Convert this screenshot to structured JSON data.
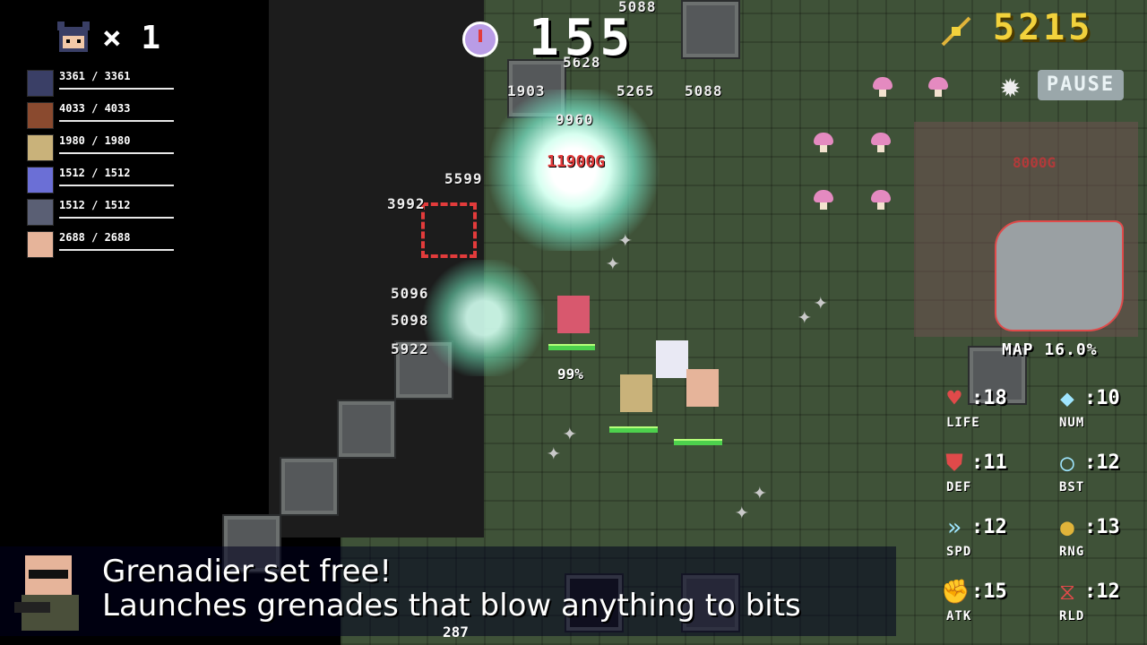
{
  "hud": {
    "lives_icon": "player-face-icon",
    "lives_text": "× 1",
    "timer_icon": "clock-icon",
    "timer": "155",
    "gold_icon": "gold-key-icon",
    "gold": "5215",
    "pause_icon": "gear-icon",
    "pause_label": "PAUSE",
    "map_label": "MAP 16.0%",
    "minimap_gold": "8000G"
  },
  "party": [
    {
      "face": "warrior-face-icon",
      "hp": "3361 / 3361"
    },
    {
      "face": "beast-face-icon",
      "hp": "4033 / 4033"
    },
    {
      "face": "elf-face-icon",
      "hp": "1980 / 1980"
    },
    {
      "face": "rabbit-face-icon",
      "hp": "1512 / 1512"
    },
    {
      "face": "fighter-face-icon",
      "hp": "1512 / 1512"
    },
    {
      "face": "grenadier-face-icon",
      "hp": "2688 / 2688"
    }
  ],
  "stats": [
    {
      "icon": "potion-icon",
      "value": ":18",
      "label": "LIFE",
      "color": "#e04a4a"
    },
    {
      "icon": "crystal-icon",
      "value": ":10",
      "label": "NUM",
      "color": "#9fe6ff"
    },
    {
      "icon": "shield-icon",
      "value": ":11",
      "label": "DEF",
      "color": "#e04a4a"
    },
    {
      "icon": "ring-icon",
      "value": ":12",
      "label": "BST",
      "color": "#9fe6ff"
    },
    {
      "icon": "boot-icon",
      "value": ":12",
      "label": "SPD",
      "color": "#9fe6ff"
    },
    {
      "icon": "bomb-icon",
      "value": ":13",
      "label": "RNG",
      "color": "#e0b43a"
    },
    {
      "icon": "fist-icon",
      "value": ":15",
      "label": "ATK",
      "color": "#e04a4a"
    },
    {
      "icon": "hourglass-icon",
      "value": ":12",
      "label": "RLD",
      "color": "#e04a4a"
    }
  ],
  "banner": {
    "portrait": "grenadier-portrait-icon",
    "title": "Grenadier set free!",
    "description": "Launches grenades that blow anything to bits"
  },
  "battle": {
    "gold_popup": "11900G",
    "percent": "99%",
    "bottom_number": "287",
    "damage_numbers": [
      "5088",
      "5628",
      "5265",
      "5088",
      "3992",
      "5096",
      "5098",
      "5922",
      "9960",
      "1903",
      "5599"
    ]
  }
}
